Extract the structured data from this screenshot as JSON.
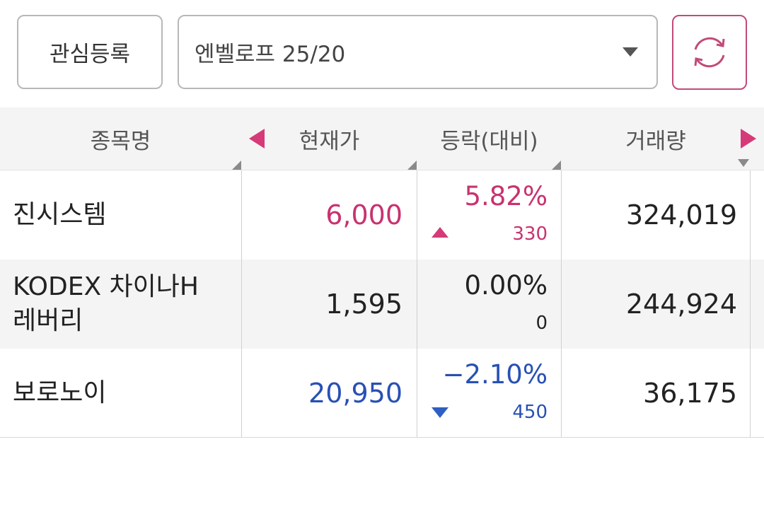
{
  "toolbar": {
    "favorite_label": "관심등록",
    "group_value": "엔벨로프 25/20",
    "refresh_icon": "refresh-icon"
  },
  "table": {
    "headers": [
      "종목명",
      "현재가",
      "등락(대비)",
      "거래량"
    ],
    "rows": [
      {
        "name_line1": "진시스템",
        "name_line2": "",
        "price": "6,000",
        "change_pct": "5.82%",
        "change_diff": "330",
        "volume": "324,019",
        "direction": "up"
      },
      {
        "name_line1": "KODEX 차이나H",
        "name_line2": "레버리",
        "price": "1,595",
        "change_pct": "0.00%",
        "change_diff": "0",
        "volume": "244,924",
        "direction": "flat"
      },
      {
        "name_line1": "보로노이",
        "name_line2": "",
        "price": "20,950",
        "change_pct": "−2.10%",
        "change_diff": "450",
        "volume": "36,175",
        "direction": "down"
      }
    ]
  },
  "colors": {
    "up": "#c8326f",
    "down": "#2850b4",
    "accent": "#c14a78"
  }
}
